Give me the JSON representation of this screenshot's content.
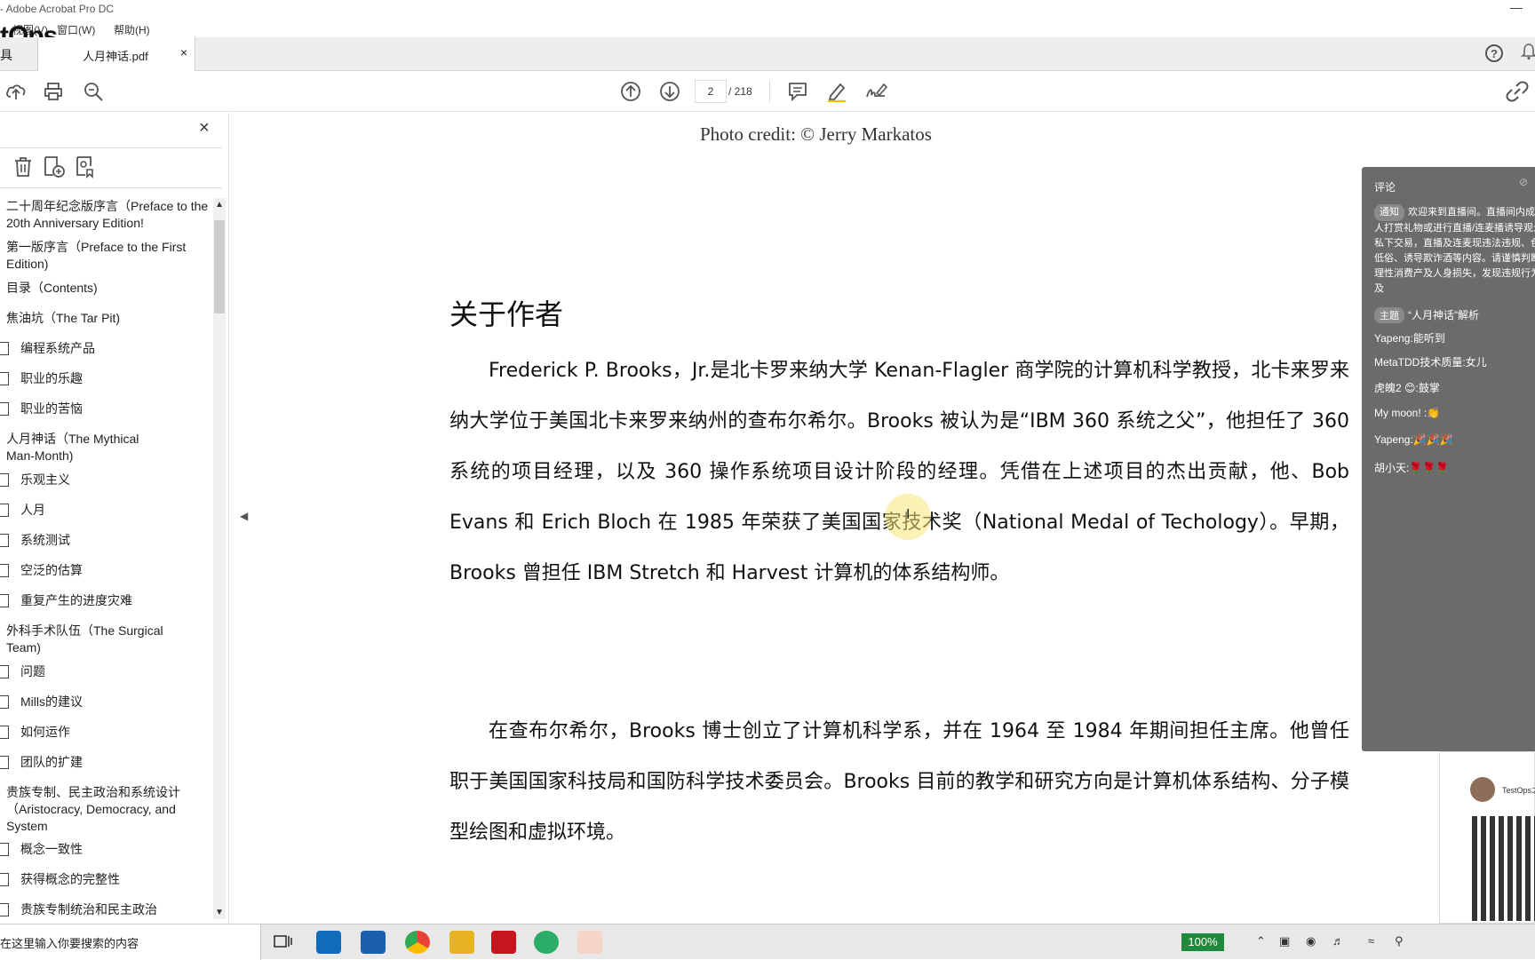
{
  "window": {
    "title": "- Adobe Acrobat Pro DC",
    "brand_overlay": "tOps",
    "menu": [
      "视图(V)",
      "窗口(W)",
      "帮助(H)"
    ],
    "minimize": "—"
  },
  "tabs": {
    "tools_stub": "具",
    "active": {
      "name": "人月神话.pdf",
      "close": "×"
    }
  },
  "toolbar": {
    "page_current": "2",
    "page_total": "/ 218",
    "help": "?"
  },
  "sidebar": {
    "close": "×",
    "bookmarks": [
      {
        "text": "二十周年纪念版序言（Preface to the 20th Anniversary Edition!",
        "level": "top"
      },
      {
        "text": "第一版序言（Preface to the First Edition)",
        "level": "top"
      },
      {
        "text": "目录（Contents)",
        "level": "top"
      },
      {
        "text": "焦油坑（The Tar Pit)",
        "level": "top"
      },
      {
        "text": "编程系统产品",
        "level": "child"
      },
      {
        "text": "职业的乐趣",
        "level": "child"
      },
      {
        "text": "职业的苦恼",
        "level": "child"
      },
      {
        "text": "人月神话（The Mythical Man-Month)",
        "level": "top"
      },
      {
        "text": "乐观主义",
        "level": "child"
      },
      {
        "text": "人月",
        "level": "child"
      },
      {
        "text": "系统测试",
        "level": "child"
      },
      {
        "text": "空泛的估算",
        "level": "child"
      },
      {
        "text": "重复产生的进度灾难",
        "level": "child"
      },
      {
        "text": "外科手术队伍（The Surgical Team)",
        "level": "top"
      },
      {
        "text": "问题",
        "level": "child"
      },
      {
        "text": "Mills的建议",
        "level": "child"
      },
      {
        "text": "如何运作",
        "level": "child"
      },
      {
        "text": "团队的扩建",
        "level": "child"
      },
      {
        "text": "贵族专制、民主政治和系统设计（Aristocracy, Democracy, and System",
        "level": "top"
      },
      {
        "text": "概念一致性",
        "level": "child"
      },
      {
        "text": "获得概念的完整性",
        "level": "child"
      },
      {
        "text": "贵族专制统治和民主政治",
        "level": "child"
      }
    ]
  },
  "document": {
    "photo_credit": "Photo credit: © Jerry Markatos",
    "heading": "关于作者",
    "paragraphs": [
      "Frederick P. Brooks，Jr.是北卡罗来纳大学 Kenan-Flagler 商学院的计算机科学教授，北卡来罗来纳大学位于美国北卡来罗来纳州的查布尔希尔。Brooks 被认为是“IBM 360 系统之父”，他担任了 360 系统的项目经理，以及 360 操作系统项目设计阶段的经理。凭借在上述项目的杰出贡献，他、Bob Evans 和 Erich Bloch 在 1985 年荣获了美国国家技术奖（National Medal of Techology）。早期，Brooks 曾担任 IBM Stretch 和 Harvest 计算机的体系结构师。",
      "在查布尔希尔，Brooks 博士创立了计算机科学系，并在 1964 至 1984 年期间担任主席。他曾任职于美国国家科技局和国防科学技术委员会。Brooks 目前的教学和研究方向是计算机体系结构、分子模型绘图和虚拟环境。"
    ]
  },
  "comments": {
    "header": "评论",
    "notice_tag": "通知",
    "notice": "欢迎来到直播间。直播间内成年人打赏礼物或进行直播/连麦播诱导观众私下交易，直播及连麦现违法违规、色情低俗、诱导欺诈酒等内容。请谨慎判断，理性消费产及人身损失，发现违规行为请及",
    "topic_tag": "主题",
    "topic": "“人月神话”解析",
    "messages": [
      "Yapeng:能听到",
      "MetaTDD技术质量:女儿",
      "虎魄2 😊:鼓掌",
      "My moon! :👏",
      "Yapeng:🎉🎉🎉",
      "胡小天:🌹🌹🌹"
    ]
  },
  "qr_card": {
    "name": "TestOps之"
  },
  "taskbar": {
    "search_placeholder": "在这里输入你要搜索的内容",
    "zoom": "100%"
  }
}
